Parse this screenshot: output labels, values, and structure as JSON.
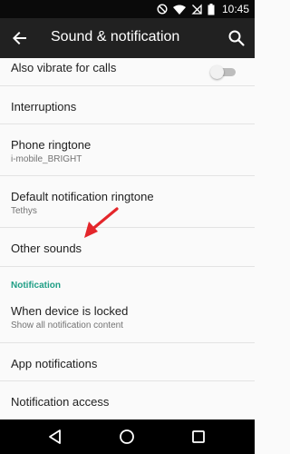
{
  "status_bar": {
    "time": "10:45"
  },
  "app_bar": {
    "title": "Sound & notification"
  },
  "settings": [
    {
      "title": "Also vibrate for calls"
    },
    {
      "title": "Interruptions"
    },
    {
      "title": "Phone ringtone",
      "subtitle": "i-mobile_BRIGHT"
    },
    {
      "title": "Default notification ringtone",
      "subtitle": "Tethys"
    },
    {
      "title": "Other sounds"
    }
  ],
  "section_header": "Notification",
  "notification_settings": [
    {
      "title": "When device is locked",
      "subtitle": "Show all notification content"
    },
    {
      "title": "App notifications"
    },
    {
      "title": "Notification access"
    }
  ],
  "toggles": {
    "also_vibrate_for_calls": false
  },
  "colors": {
    "accent": "#1e9e85",
    "annotation_arrow": "#e4262b"
  }
}
